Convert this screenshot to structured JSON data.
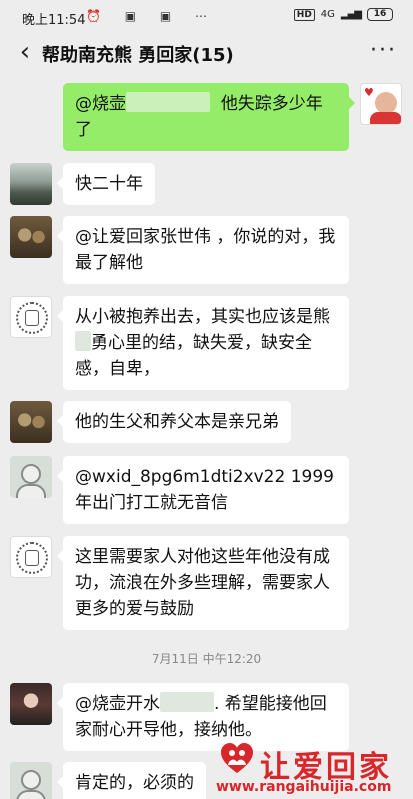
{
  "status_bar": {
    "time": "晚上11:54",
    "icons": "⏰ ▣ ▣ ⋯",
    "hd": "HD",
    "network": "4G",
    "battery": "16"
  },
  "header": {
    "back_icon": "‹",
    "title": "帮助南充熊      勇回家(15)",
    "more_icon": "···"
  },
  "messages": [
    {
      "side": "right",
      "text_a": "@烧壶",
      "text_b": "他失踪多少年了"
    },
    {
      "side": "left",
      "text": "快二十年"
    },
    {
      "side": "left",
      "text": "@让爱回家张世伟 ，你说的对，我最了解他"
    },
    {
      "side": "left",
      "text_a": "从小被抱养出去，其实也应该是熊",
      "text_b": "勇心里的结，缺失爱，缺安全感，自卑，"
    },
    {
      "side": "left",
      "text": "他的生父和养父本是亲兄弟"
    },
    {
      "side": "left",
      "text": "@wxid_8pg6m1dti2xv22 1999 年出门打工就无音信"
    },
    {
      "side": "left",
      "text": "这里需要家人对他这些年他没有成功，流浪在外多些理解，需要家人更多的爱与鼓励"
    },
    {
      "side": "left",
      "text_a": "@烧壶开水",
      "text_b": ". 希望能接他回家耐心开导他，接纳他。"
    },
    {
      "side": "left",
      "text": "肯定的，必须的"
    }
  ],
  "timestamp": "7月11日 中午12:20",
  "watermark": {
    "text": "让爱回家",
    "url": "www.rangaihuijia.com"
  }
}
